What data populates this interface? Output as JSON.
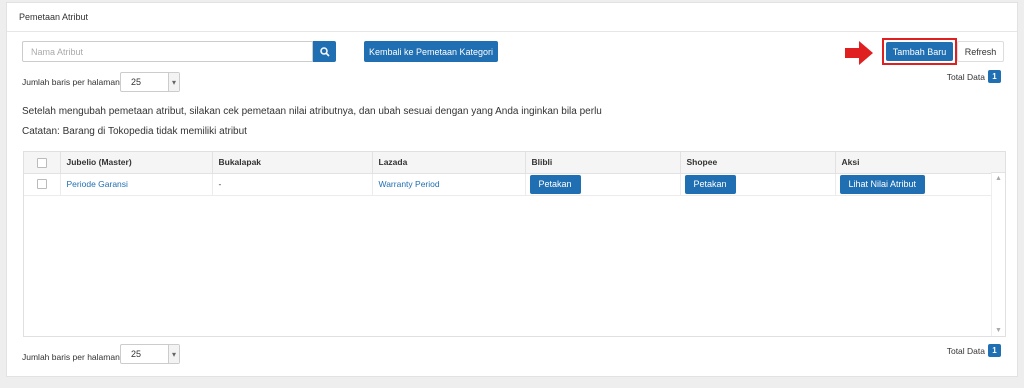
{
  "panel": {
    "title": "Pemetaan Atribut"
  },
  "search": {
    "placeholder": "Nama Atribut"
  },
  "toolbar": {
    "back_label": "Kembali ke Pemetaan Kategori",
    "add_label": "Tambah Baru",
    "refresh_label": "Refresh"
  },
  "pagination_top": {
    "rows_label": "Jumlah baris per halaman",
    "rows_value": "25",
    "total_label": "Total Data",
    "total_value": "1"
  },
  "notes": {
    "line1": "Setelah mengubah pemetaan atribut, silakan cek pemetaan nilai atributnya, dan ubah sesuai dengan yang Anda inginkan bila perlu",
    "line2": "Catatan: Barang di Tokopedia tidak memiliki atribut"
  },
  "table": {
    "headers": [
      "Jubelio (Master)",
      "Bukalapak",
      "Lazada",
      "Blibli",
      "Shopee",
      "Aksi"
    ],
    "rows": [
      {
        "master": "Periode Garansi",
        "bukalapak": "-",
        "lazada": "Warranty Period",
        "blibli_btn": "Petakan",
        "shopee_btn": "Petakan",
        "aksi_btn": "Lihat Nilai Atribut"
      }
    ]
  },
  "pagination_bottom": {
    "rows_label": "Jumlah baris per halaman",
    "rows_value": "25",
    "total_label": "Total Data",
    "total_value": "1"
  },
  "colors": {
    "primary": "#1f6fb2",
    "highlight": "#e02020"
  },
  "icons": {
    "search": "search-icon",
    "arrow": "arrow-right-icon",
    "caret": "chevron-down-icon"
  }
}
